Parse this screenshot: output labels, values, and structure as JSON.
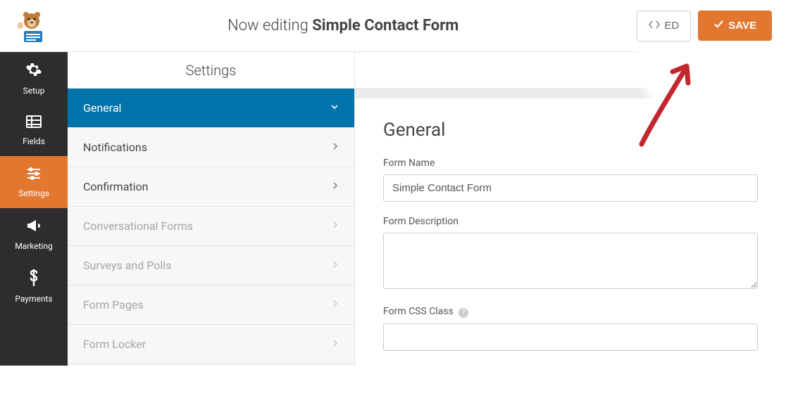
{
  "header": {
    "now_editing": "Now editing",
    "form_name": "Simple Contact Form",
    "embed_label": "ED",
    "save_label": "SAVE"
  },
  "sidebar": {
    "items": [
      {
        "label": "Setup",
        "icon": "gear"
      },
      {
        "label": "Fields",
        "icon": "list"
      },
      {
        "label": "Settings",
        "icon": "sliders",
        "active": true
      },
      {
        "label": "Marketing",
        "icon": "bullhorn"
      },
      {
        "label": "Payments",
        "icon": "dollar"
      }
    ]
  },
  "settings": {
    "title": "Settings",
    "items": [
      {
        "label": "General",
        "active": true,
        "expanded": true
      },
      {
        "label": "Notifications"
      },
      {
        "label": "Confirmation"
      },
      {
        "label": "Conversational Forms",
        "muted": true
      },
      {
        "label": "Surveys and Polls",
        "muted": true
      },
      {
        "label": "Form Pages",
        "muted": true
      },
      {
        "label": "Form Locker",
        "muted": true
      }
    ]
  },
  "form_panel": {
    "heading": "General",
    "fields": {
      "name": {
        "label": "Form Name",
        "value": "Simple Contact Form"
      },
      "description": {
        "label": "Form Description",
        "value": ""
      },
      "css_class": {
        "label": "Form CSS Class",
        "value": ""
      }
    }
  },
  "colors": {
    "accent": "#e27730",
    "primary_blue": "#0073aa",
    "dark": "#2d2d2d"
  }
}
